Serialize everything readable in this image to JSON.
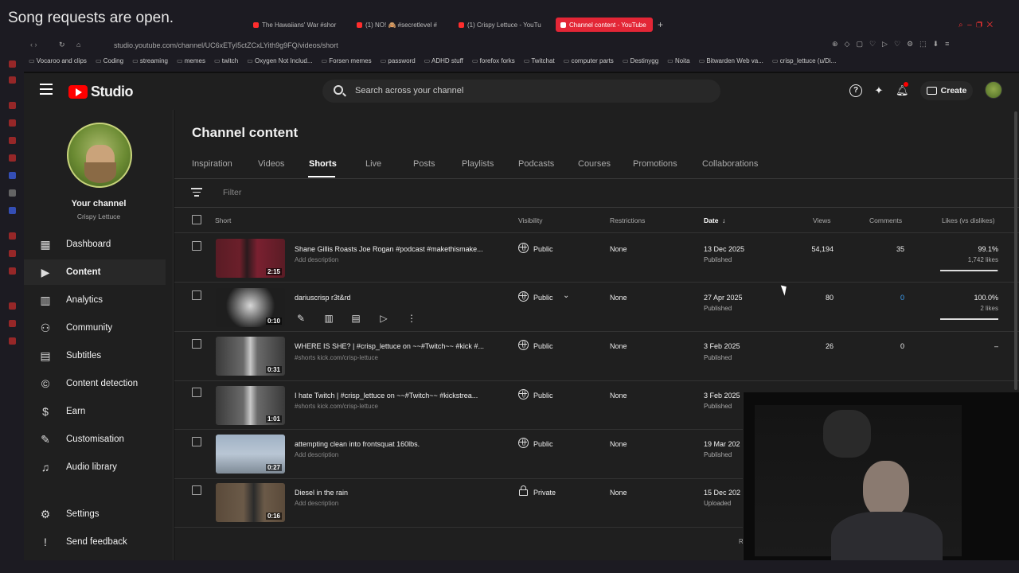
{
  "overlay": {
    "text": "Song requests are open."
  },
  "browser": {
    "tabs": [
      {
        "label": "The Hawaiians' War #shor"
      },
      {
        "label": "(1) NO! 🙈 #secretlevel #"
      },
      {
        "label": "(1) Crispy Lettuce - YouTu"
      },
      {
        "label": "Channel content - YouTube"
      }
    ],
    "url": "studio.youtube.com/channel/UC6xETyI5ctZCxLYith9g9FQ/videos/short",
    "bookmarks": [
      "Vocaroo and clips",
      "Coding",
      "streaming",
      "memes",
      "twitch",
      "Oxygen Not Includ...",
      "Forsen memes",
      "password",
      "ADHD stuff",
      "forefox forks",
      "Twitchat",
      "computer parts",
      "Destinygg",
      "Noita",
      "Bitwarden Web va...",
      "crisp_lettuce (u/Di..."
    ]
  },
  "header": {
    "logo_text": "Studio",
    "search_placeholder": "Search across your channel",
    "create_label": "Create"
  },
  "sidebar": {
    "channel_title": "Your channel",
    "channel_name": "Crispy Lettuce",
    "items": [
      {
        "label": "Dashboard",
        "icon": "dashboard-icon"
      },
      {
        "label": "Content",
        "icon": "content-icon"
      },
      {
        "label": "Analytics",
        "icon": "analytics-icon"
      },
      {
        "label": "Community",
        "icon": "community-icon"
      },
      {
        "label": "Subtitles",
        "icon": "subtitles-icon"
      },
      {
        "label": "Content detection",
        "icon": "copyright-icon"
      },
      {
        "label": "Earn",
        "icon": "earn-icon"
      },
      {
        "label": "Customisation",
        "icon": "customisation-icon"
      },
      {
        "label": "Audio library",
        "icon": "audio-library-icon"
      },
      {
        "label": "Settings",
        "icon": "gear-icon"
      },
      {
        "label": "Send feedback",
        "icon": "feedback-icon"
      }
    ]
  },
  "main": {
    "title": "Channel content",
    "tabs": [
      "Inspiration",
      "Videos",
      "Shorts",
      "Live",
      "Posts",
      "Playlists",
      "Podcasts",
      "Courses",
      "Promotions",
      "Collaborations"
    ],
    "active_tab": "Shorts",
    "filter_placeholder": "Filter",
    "columns": {
      "short": "Short",
      "visibility": "Visibility",
      "restrictions": "Restrictions",
      "date": "Date",
      "views": "Views",
      "comments": "Comments",
      "likes": "Likes (vs dislikes)"
    },
    "rows": [
      {
        "title": "Shane Gillis Roasts Joe Rogan #podcast #makethismake...",
        "desc": "Add description",
        "duration": "2:15",
        "visibility": "Public",
        "restrictions": "None",
        "date": "13 Dec 2025",
        "date_status": "Published",
        "views": "54,194",
        "comments": "35",
        "likes": "99.1%",
        "likes_count": "1,742 likes",
        "likes_fraction": 0.991
      },
      {
        "title": "dariuscrisp r3t&rd",
        "desc": "",
        "duration": "0:10",
        "visibility": "Public",
        "restrictions": "None",
        "date": "27 Apr 2025",
        "date_status": "Published",
        "views": "80",
        "comments": "0",
        "likes": "100.0%",
        "likes_count": "2 likes",
        "likes_fraction": 1.0
      },
      {
        "title": "WHERE IS SHE? | #crisp_lettuce on ~~#Twitch~~ #kick #...",
        "desc": "#shorts kick.com/crisp-lettuce",
        "duration": "0:31",
        "visibility": "Public",
        "restrictions": "None",
        "date": "3 Feb 2025",
        "date_status": "Published",
        "views": "26",
        "comments": "0",
        "likes": "–",
        "likes_count": "",
        "likes_fraction": null
      },
      {
        "title": "I hate Twitch | #crisp_lettuce on ~~#Twitch~~ #kickstrea...",
        "desc": "#shorts kick.com/crisp-lettuce",
        "duration": "1:01",
        "visibility": "Public",
        "restrictions": "None",
        "date": "3 Feb 2025",
        "date_status": "Published",
        "views": "",
        "comments": "",
        "likes": "",
        "likes_count": "",
        "likes_fraction": null
      },
      {
        "title": "attempting clean into frontsquat 160lbs.",
        "desc": "Add description",
        "duration": "0:27",
        "visibility": "Public",
        "restrictions": "None",
        "date": "19 Mar 202",
        "date_status": "Published",
        "views": "",
        "comments": "",
        "likes": "",
        "likes_count": "",
        "likes_fraction": null
      },
      {
        "title": "Diesel in the rain",
        "desc": "Add description",
        "duration": "0:16",
        "visibility": "Private",
        "restrictions": "None",
        "date": "15 Dec 202",
        "date_status": "Uploaded",
        "views": "",
        "comments": "",
        "likes": "",
        "likes_count": "",
        "likes_fraction": null
      }
    ],
    "footer_partial": "R"
  },
  "colors": {
    "accent": "#ff0000",
    "tab_active": "#e32636",
    "comments_link": "#3ea6ff"
  }
}
